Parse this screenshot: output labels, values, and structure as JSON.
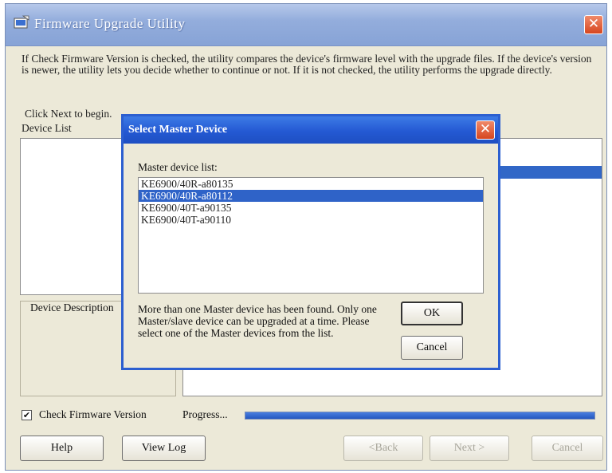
{
  "window": {
    "title": "Firmware Upgrade Utility",
    "close_glyph": "✕"
  },
  "intro_text": "If Check Firmware Version is checked, the utility compares the device's firmware level with the upgrade files. If the device's version is newer, the utility lets you decide whether to continue or not. If it is not checked, the utility performs the upgrade directly.",
  "click_next_text": "Click Next to begin.",
  "device_list_label": "Device List",
  "device_description_label": "Device Description",
  "check_firmware": {
    "label": "Check Firmware Version",
    "checked": true,
    "glyph": "✔"
  },
  "progress": {
    "label": "Progress...",
    "percent": 100
  },
  "buttons": {
    "help": "Help",
    "view_log": "View Log",
    "back": "<Back",
    "next": "Next >",
    "cancel": "Cancel"
  },
  "dialog": {
    "title": "Select Master Device",
    "close_glyph": "✕",
    "list_label": "Master device list:",
    "items": [
      {
        "label": "KE6900/40R-a80135",
        "selected": false
      },
      {
        "label": "KE6900/40R-a80112",
        "selected": true
      },
      {
        "label": "KE6900/40T-a90135",
        "selected": false
      },
      {
        "label": "KE6900/40T-a90110",
        "selected": false
      }
    ],
    "message": "More than one Master device has been found. Only one Master/slave device can be upgraded at a time. Please select one of the Master devices from the list.",
    "ok_label": "OK",
    "cancel_label": "Cancel"
  },
  "colors": {
    "selection": "#2f63c8",
    "dialog_title": "#2459d3",
    "close_button": "#d6461f"
  }
}
